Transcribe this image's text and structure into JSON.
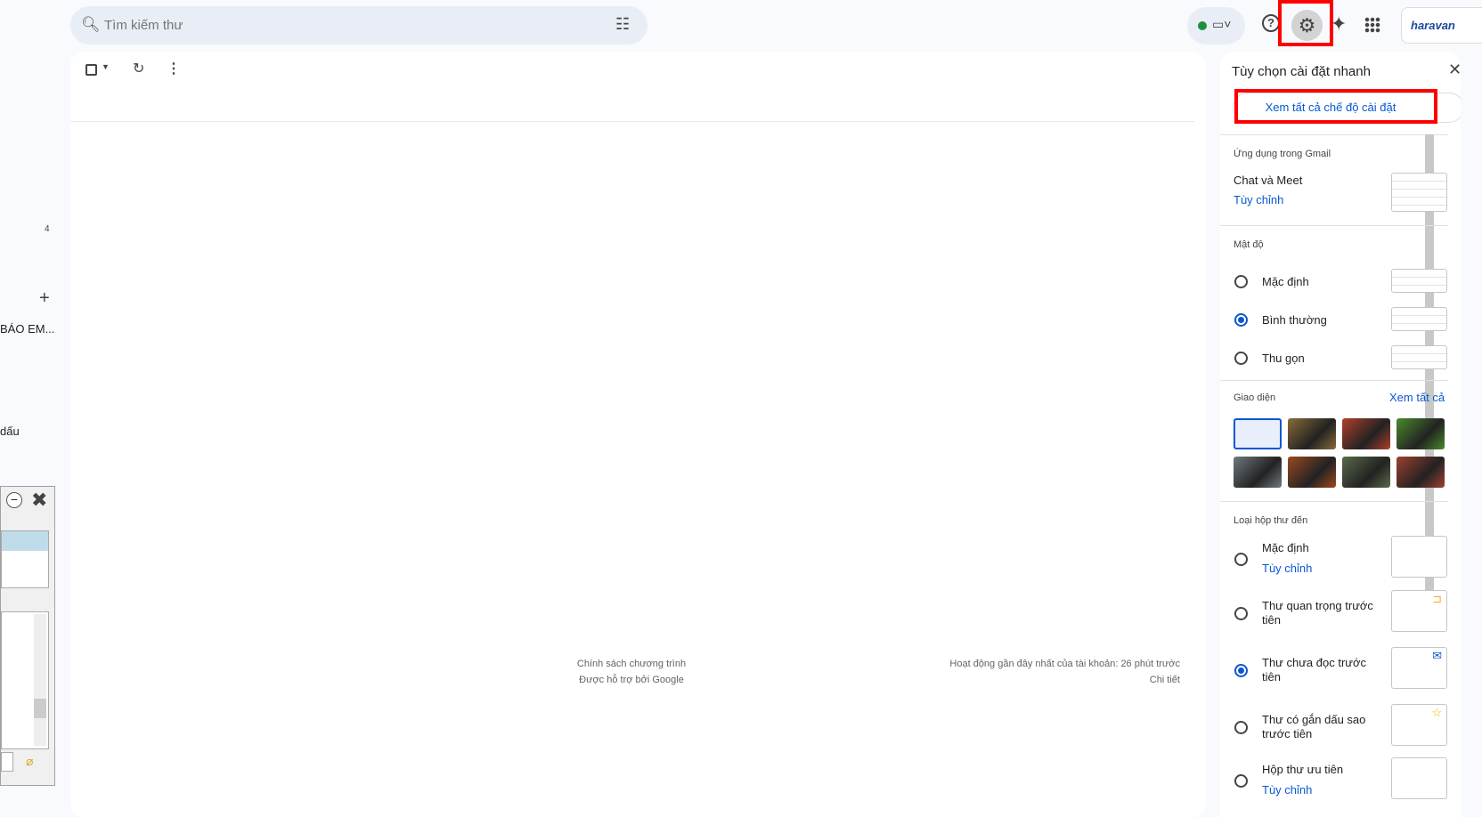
{
  "search": {
    "placeholder": "Tìm kiếm thư",
    "icon": "search-icon",
    "filter_icon": "tune-icon"
  },
  "topbar": {
    "status_color": "#1e8e3e",
    "help": "?",
    "gear": "⚙",
    "sparkle": "✦",
    "apps": "⋮⋮⋮",
    "brand": "haravan"
  },
  "toolbar": {
    "select_icon": "checkbox-icon",
    "refresh_icon": "refresh-icon",
    "more_icon": "more-vert-icon"
  },
  "footer": {
    "policy": "Chính sách chương trình",
    "powered": "Được hỗ trợ bởi Google",
    "activity": "Hoạt động gần đây nhất của tài khoản: 26 phút trước",
    "details": "Chi tiết"
  },
  "sidebar": {
    "count": "4",
    "plus": "+",
    "label1": "BÁO EM...",
    "label2": "dấu"
  },
  "panel": {
    "title": "Tùy chọn cài đặt nhanh",
    "see_all": "Xem tất cả chế độ cài đặt",
    "apps_section": "Ứng dụng trong Gmail",
    "chat_meet": "Chat và Meet",
    "customize": "Tùy chỉnh",
    "density_section": "Mật độ",
    "density": [
      {
        "label": "Mặc định",
        "selected": false
      },
      {
        "label": "Bình thường",
        "selected": true
      },
      {
        "label": "Thu gọn",
        "selected": false
      }
    ],
    "theme_section": "Giao diện",
    "theme_see_all": "Xem tất cả",
    "themes": [
      "#e8eefa",
      "#8a6a3a",
      "#b0402a",
      "#4a8a2a",
      "#707a80",
      "#9a4a20",
      "#5a6a4a",
      "#a04030"
    ],
    "inbox_section": "Loại hộp thư đến",
    "inbox": [
      {
        "label": "Mặc định",
        "link": "Tùy chỉnh",
        "selected": false
      },
      {
        "label": "Thư quan trọng trước tiên",
        "selected": false
      },
      {
        "label": "Thư chưa đọc trước tiên",
        "selected": true
      },
      {
        "label": "Thư có gắn dấu sao trước tiên",
        "selected": false
      },
      {
        "label": "Hộp thư ưu tiên",
        "link": "Tùy chỉnh",
        "selected": false
      }
    ]
  }
}
